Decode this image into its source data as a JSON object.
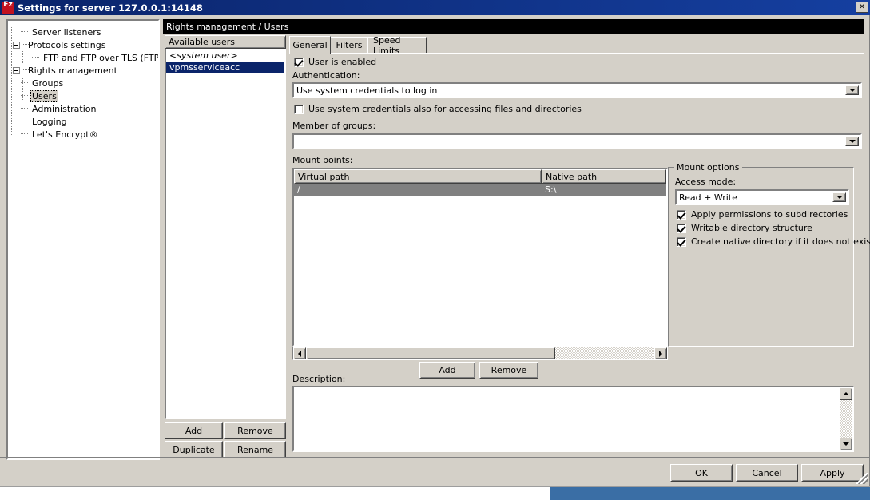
{
  "window": {
    "title": "Settings for server 127.0.0.1:14148",
    "icon": "filezilla-icon",
    "close_label": "✕"
  },
  "sidebar": {
    "items": [
      {
        "label": "Server listeners",
        "depth": 1,
        "expander": false,
        "selected": false
      },
      {
        "label": "Protocols settings",
        "depth": 0,
        "expander": true,
        "selected": false
      },
      {
        "label": "FTP and FTP over TLS (FTPS)",
        "depth": 2,
        "expander": false,
        "selected": false
      },
      {
        "label": "Rights management",
        "depth": 0,
        "expander": true,
        "selected": false
      },
      {
        "label": "Groups",
        "depth": 1,
        "expander": false,
        "selected": false
      },
      {
        "label": "Users",
        "depth": 1,
        "expander": false,
        "selected": true
      },
      {
        "label": "Administration",
        "depth": 1,
        "expander": false,
        "selected": false
      },
      {
        "label": "Logging",
        "depth": 1,
        "expander": false,
        "selected": false
      },
      {
        "label": "Let's Encrypt®",
        "depth": 1,
        "expander": false,
        "selected": false
      }
    ]
  },
  "users_panel": {
    "header": "Available users",
    "items": [
      {
        "label": "<system user>",
        "italic": true,
        "selected": false
      },
      {
        "label": "vpmsserviceacc",
        "italic": false,
        "selected": true
      }
    ],
    "buttons": {
      "add": "Add",
      "remove": "Remove",
      "duplicate": "Duplicate",
      "rename": "Rename"
    }
  },
  "content": {
    "header": "Rights management / Users",
    "tabs": [
      {
        "label": "General",
        "active": true
      },
      {
        "label": "Filters",
        "active": false
      },
      {
        "label": "Speed Limits",
        "active": false
      }
    ],
    "user_enabled": {
      "label": "User is enabled",
      "checked": true
    },
    "authentication": {
      "label": "Authentication:",
      "value": "Use system credentials to log in"
    },
    "use_system_credentials_files": {
      "label": "Use system credentials also for accessing files and directories",
      "checked": false
    },
    "member_of_groups": {
      "label": "Member of groups:",
      "value": ""
    },
    "mount_points": {
      "label": "Mount points:",
      "columns": [
        "Virtual path",
        "Native path"
      ],
      "rows": [
        {
          "virtual_path": "/",
          "native_path": "S:\\",
          "selected": true
        }
      ],
      "buttons": {
        "add": "Add",
        "remove": "Remove"
      }
    },
    "mount_options": {
      "title": "Mount options",
      "access_mode": {
        "label": "Access mode:",
        "value": "Read + Write"
      },
      "checkboxes": [
        {
          "label": "Apply permissions to subdirectories",
          "checked": true
        },
        {
          "label": "Writable directory structure",
          "checked": true
        },
        {
          "label": "Create native directory if it does not exist",
          "checked": true
        }
      ]
    },
    "description": {
      "label": "Description:",
      "value": ""
    }
  },
  "footer": {
    "ok": "OK",
    "cancel": "Cancel",
    "apply": "Apply"
  }
}
